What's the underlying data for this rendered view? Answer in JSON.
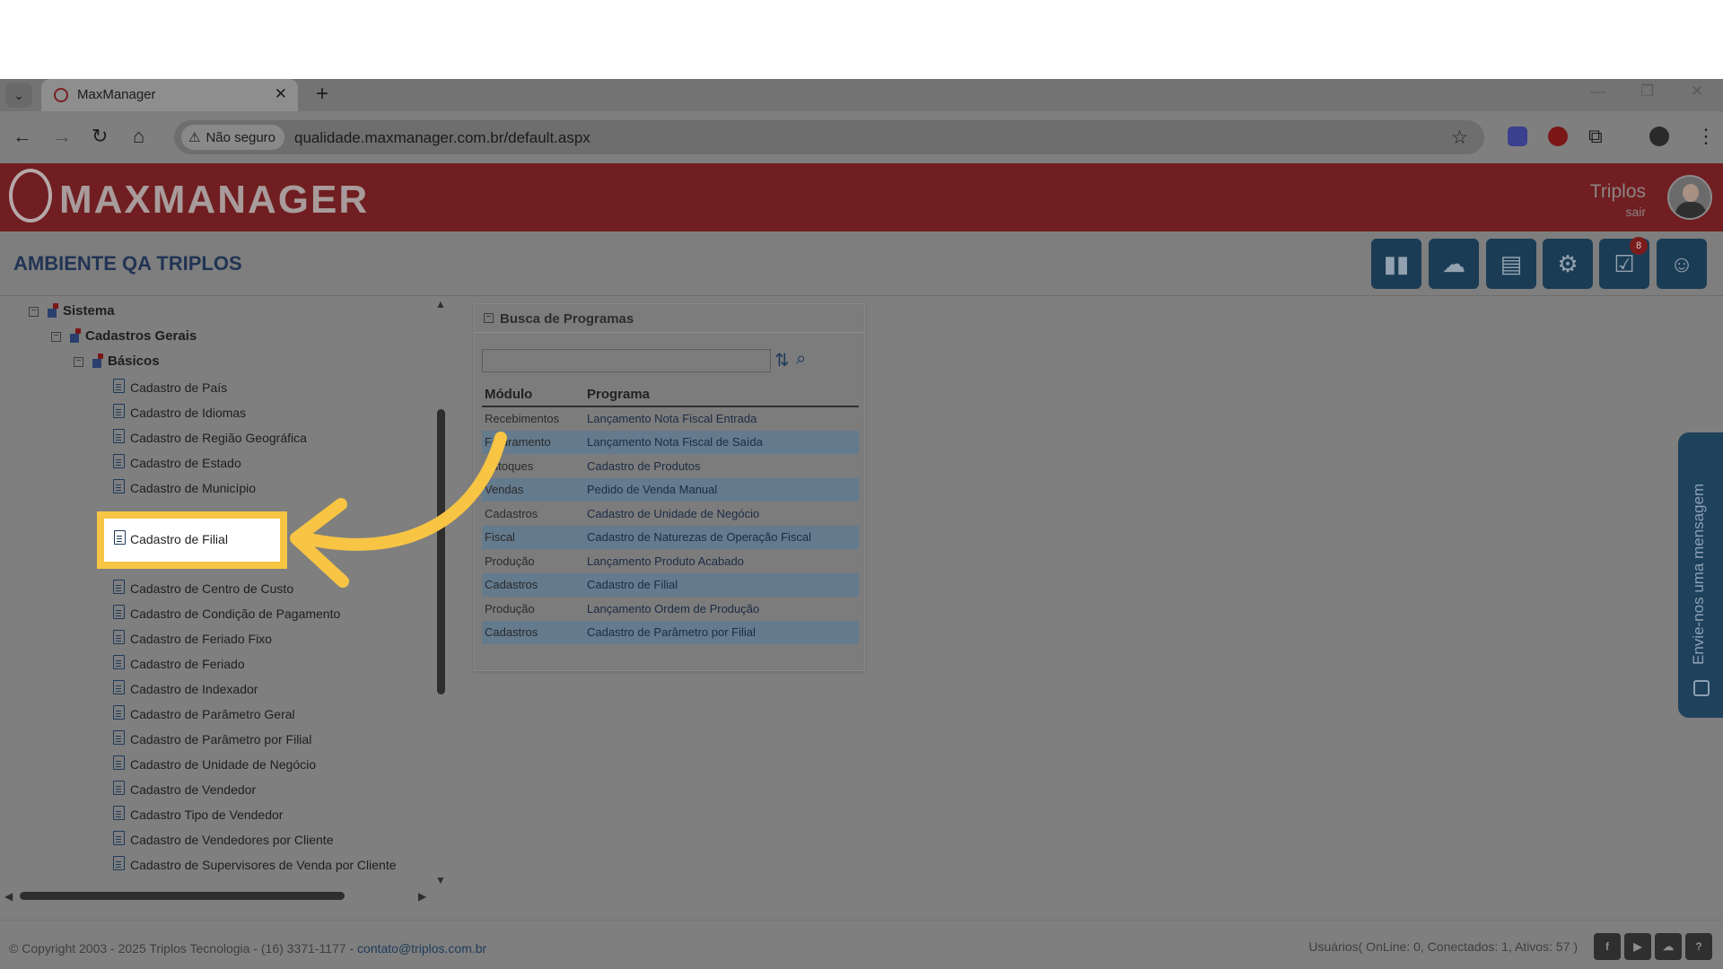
{
  "browser": {
    "tab_title": "MaxManager",
    "security_label": "Não seguro",
    "url": "qualidade.maxmanager.com.br/default.aspx"
  },
  "app": {
    "logo_text": "MAXMANAGER",
    "user_name": "Triplos",
    "logout_label": "sair",
    "environment_title": "AMBIENTE QA TRIPLOS",
    "notification_count": "8"
  },
  "tree": {
    "root": "Sistema",
    "level1": "Cadastros Gerais",
    "level2": "Básicos",
    "items": [
      "Cadastro de País",
      "Cadastro de Idiomas",
      "Cadastro de Região Geográfica",
      "Cadastro de Estado",
      "Cadastro de Município",
      "Cadastro de Filial",
      "Cadastro de Centro de Custo",
      "Cadastro de Condição de Pagamento",
      "Cadastro de Feriado Fixo",
      "Cadastro de Feriado",
      "Cadastro de Indexador",
      "Cadastro de Parâmetro Geral",
      "Cadastro de Parâmetro por Filial",
      "Cadastro de Unidade de Negócio",
      "Cadastro de Vendedor",
      "Cadastro Tipo de Vendedor",
      "Cadastro de Vendedores por Cliente",
      "Cadastro de Supervisores de Venda por Cliente"
    ]
  },
  "busca": {
    "title": "Busca de Programas",
    "col_modulo": "Módulo",
    "col_programa": "Programa",
    "rows": [
      {
        "modulo": "Recebimentos",
        "programa": "Lançamento Nota Fiscal Entrada"
      },
      {
        "modulo": "Faturamento",
        "programa": "Lançamento Nota Fiscal de Saída"
      },
      {
        "modulo": "Estoques",
        "programa": "Cadastro de Produtos"
      },
      {
        "modulo": "Vendas",
        "programa": "Pedido de Venda Manual"
      },
      {
        "modulo": "Cadastros",
        "programa": "Cadastro de Unidade de Negócio"
      },
      {
        "modulo": "Fiscal",
        "programa": "Cadastro de Naturezas de Operação Fiscal"
      },
      {
        "modulo": "Produção",
        "programa": "Lançamento Produto Acabado"
      },
      {
        "modulo": "Cadastros",
        "programa": "Cadastro de Filial"
      },
      {
        "modulo": "Produção",
        "programa": "Lançamento Ordem de Produção"
      },
      {
        "modulo": "Cadastros",
        "programa": "Cadastro de Parâmetro por Filial"
      }
    ]
  },
  "chat": {
    "label": "Envie-nos uma mensagem"
  },
  "footer": {
    "copyright": "© Copyright 2003 - 2025 Triplos Tecnologia - (16) 3371-1177 - ",
    "email": "contato@triplos.com.br",
    "users_status": "Usuários( OnLine: 0, Conectados: 1, Ativos: 57 )"
  },
  "highlight": {
    "label": "Cadastro de Filial",
    "color": "#f7c543"
  },
  "colors": {
    "brand": "#701e21",
    "accent": "#1b3c55"
  }
}
